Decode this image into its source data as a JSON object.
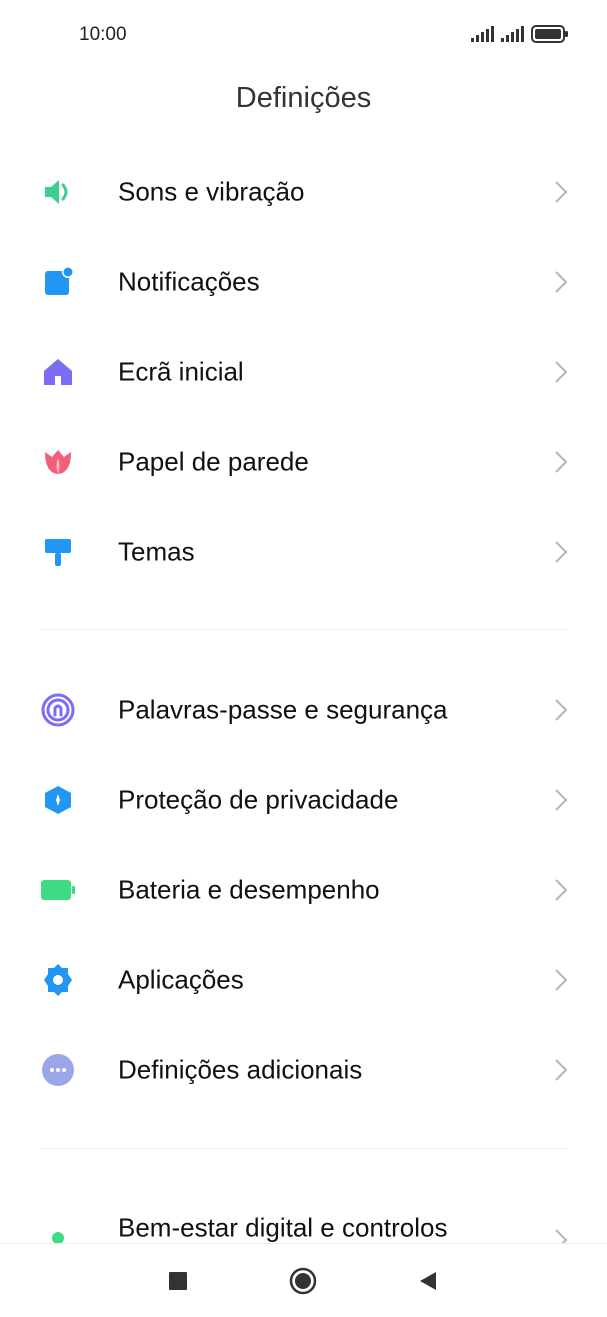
{
  "status": {
    "time": "10:00"
  },
  "header": {
    "title": "Definições"
  },
  "group1": [
    {
      "label": "Sons e vibração",
      "icon": "speaker-icon"
    },
    {
      "label": "Notificações",
      "icon": "notification-icon"
    },
    {
      "label": "Ecrã inicial",
      "icon": "home-icon"
    },
    {
      "label": "Papel de parede",
      "icon": "tulip-icon"
    },
    {
      "label": "Temas",
      "icon": "paint-brush-icon"
    }
  ],
  "group2": [
    {
      "label": "Palavras-passe e segurança",
      "icon": "fingerprint-icon"
    },
    {
      "label": "Proteção de privacidade",
      "icon": "shield-icon"
    },
    {
      "label": "Bateria e desempenho",
      "icon": "battery-icon"
    },
    {
      "label": "Aplicações",
      "icon": "gear-icon"
    },
    {
      "label": "Definições adicionais",
      "icon": "more-icon"
    }
  ],
  "group3": [
    {
      "label": "Bem-estar digital e controlos",
      "icon": "person-icon"
    }
  ],
  "colors": {
    "sound": "#3ecf8e",
    "notification": "#2196f3",
    "home": "#7b6cf6",
    "wallpaper": "#f25f7a",
    "themes": "#2196f3",
    "security": "#7b6cf6",
    "privacy": "#2196f3",
    "battery": "#3ddc84",
    "apps": "#2196f3",
    "more": "#9aa6e8",
    "wellbeing": "#3ddc84"
  }
}
